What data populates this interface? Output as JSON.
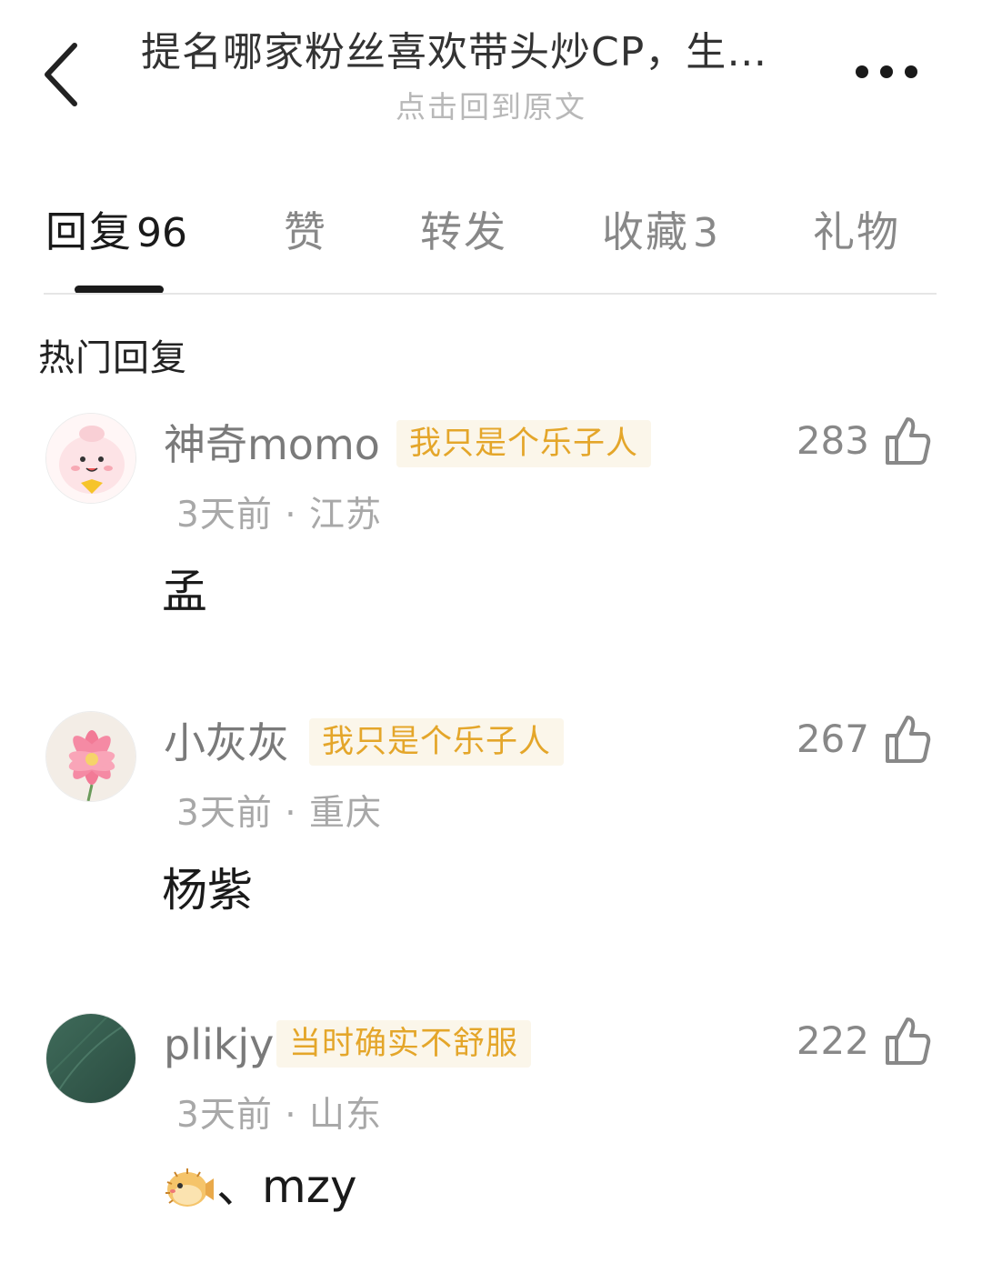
{
  "header": {
    "title": "提名哪家粉丝喜欢带头炒CP，生…",
    "subtitle": "点击回到原文",
    "back_icon": "back-arrow-icon",
    "more_icon": "more-dots-icon"
  },
  "tabs": [
    {
      "label": "回复",
      "count": "96",
      "active": true
    },
    {
      "label": "赞",
      "count": ""
    },
    {
      "label": "转发",
      "count": ""
    },
    {
      "label": "收藏",
      "count": "3"
    },
    {
      "label": "礼物",
      "count": ""
    }
  ],
  "section": {
    "title": "热门回复"
  },
  "comments": [
    {
      "username": "神奇momo",
      "badge": "我只是个乐子人",
      "likes": "283",
      "time": "3天前",
      "location": "江苏",
      "meta": "3天前 · 江苏",
      "text": "孟",
      "avatar": "cartoon-avatar"
    },
    {
      "username": "小灰灰",
      "badge": "我只是个乐子人",
      "likes": "267",
      "time": "3天前",
      "location": "重庆",
      "meta": "3天前 · 重庆",
      "text": "杨紫",
      "avatar": "lotus-avatar"
    },
    {
      "username": "plikjy",
      "badge": "当时确实不舒服",
      "likes": "222",
      "time": "3天前",
      "location": "山东",
      "meta": "3天前 · 山东",
      "text": "、mzy",
      "emoji": "pufferfish-emoji",
      "avatar": "green-avatar"
    }
  ],
  "colors": {
    "badge_bg": "#fbf6ea",
    "badge_text": "#e4a62a",
    "muted": "#a8a8a8",
    "active_tab": "#1a1a1a"
  }
}
